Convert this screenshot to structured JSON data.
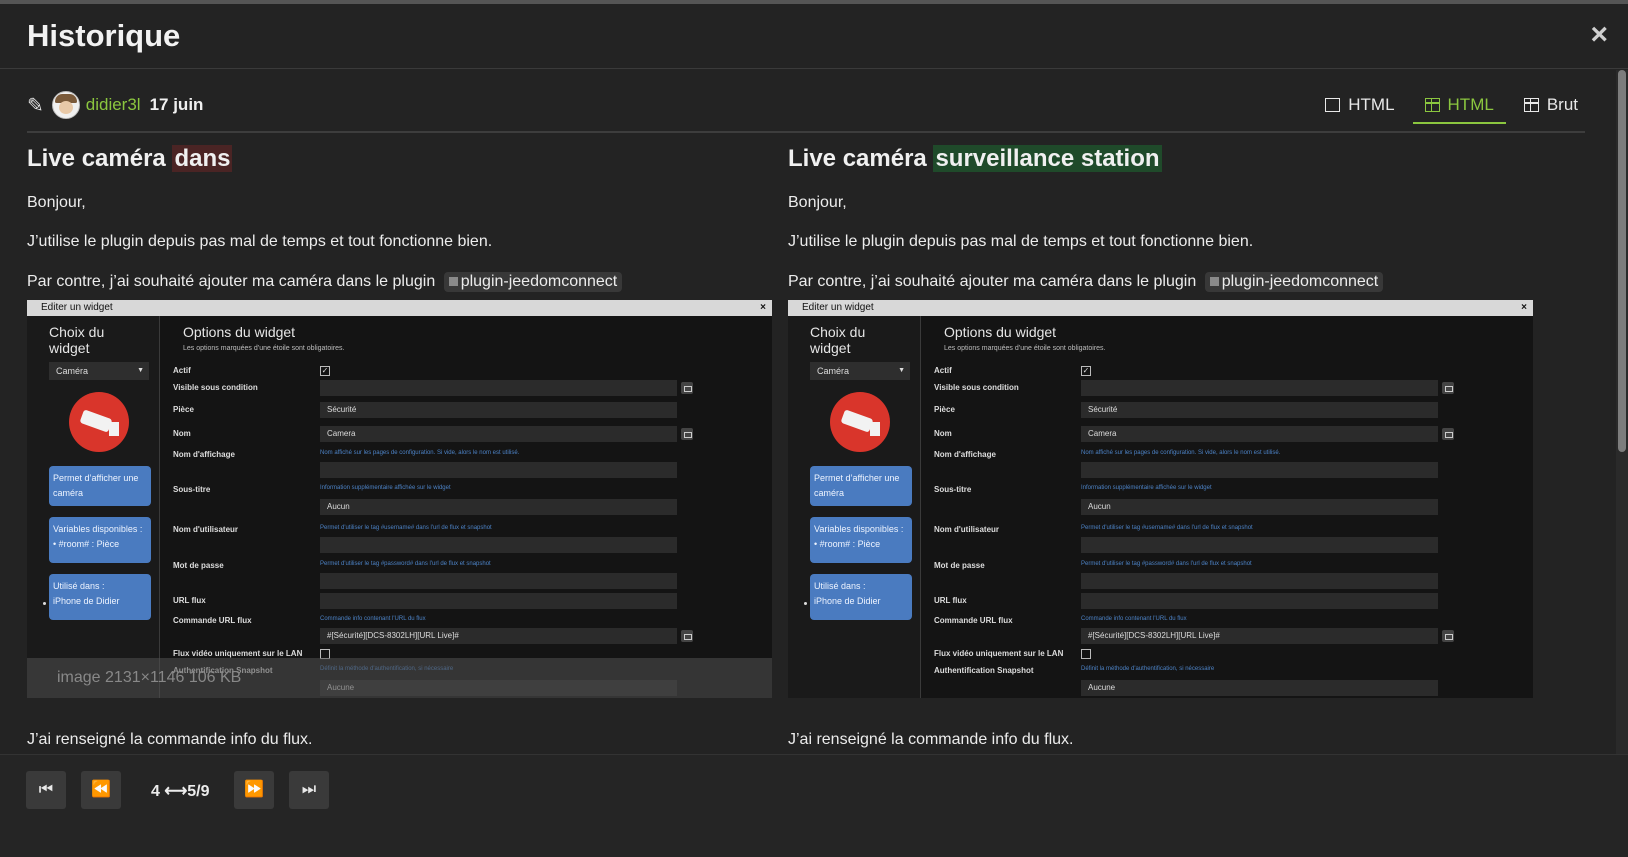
{
  "modal": {
    "title": "Historique",
    "close": "×"
  },
  "meta": {
    "username": "didier3l",
    "date": "17 juin"
  },
  "tabs": [
    {
      "label": "HTML",
      "icon": "square-icon",
      "active": false
    },
    {
      "label": "HTML",
      "icon": "split-view-icon",
      "active": true
    },
    {
      "label": "Brut",
      "icon": "columns-icon",
      "active": false
    }
  ],
  "colors": {
    "accent": "#8bc63f",
    "deletion": "#4a2424",
    "insertion": "#1f4a2a"
  },
  "left": {
    "title_plain": "Live caméra",
    "title_deleted": "dans",
    "p1": "Bonjour,",
    "p2": "J’utilise le plugin depuis pas mal de temps et tout fonctionne bien.",
    "p3": "Par contre, j’ai souhaité ajouter ma caméra dans le plugin",
    "tag": "plugin-jeedomconnect",
    "caption": "image 2131×1146 106 KB",
    "p4": "J’ai renseigné la commande info du flux."
  },
  "right": {
    "title_plain": "Live caméra",
    "title_inserted": "surveillance station",
    "p1": "Bonjour,",
    "p2": "J’utilise le plugin depuis pas mal de temps et tout fonctionne bien.",
    "p3": "Par contre, j’ai souhaité ajouter ma caméra dans le plugin",
    "tag": "plugin-jeedomconnect",
    "p4": "J’ai renseigné la commande info du flux."
  },
  "screenshot": {
    "window_title": "Editer un widget",
    "close": "×",
    "sidebar_title": "Choix du widget",
    "sidebar_select": "Caméra",
    "card1": "Permet d’afficher une caméra",
    "card2_title": "Variables disponibles :",
    "card2_item": "#room# : Pièce",
    "card3_title": "Utilisé dans :",
    "card3_item": "iPhone de Didier",
    "form_title": "Options du widget",
    "form_subtitle": "Les options marquées d’une étoile sont obligatoires.",
    "labels": {
      "actif": "Actif",
      "visible": "Visible sous condition",
      "piece": "Pièce",
      "nom": "Nom",
      "nom_affichage": "Nom d'affichage",
      "sous_titre": "Sous-titre",
      "nom_utilisateur": "Nom d'utilisateur",
      "mot_de_passe": "Mot de passe",
      "url_flux": "URL flux",
      "commande_url_flux": "Commande URL flux",
      "flux_lan": "Flux vidéo uniquement sur le LAN",
      "auth_snapshot": "Authentification Snapshot"
    },
    "values": {
      "piece": "Sécurité",
      "nom": "Camera",
      "sous_titre": "Aucun",
      "commande": "#[Sécurité][DCS-8302LH][URL Live]#",
      "auth": "Aucune"
    },
    "hints": {
      "nom_affichage": "Nom affiché sur les pages de configuration. Si vide, alors le nom est utilisé.",
      "sous_titre": "Information supplémentaire affichée sur le widget",
      "nom_utilisateur": "Permet d'utiliser le tag #username# dans l'url de flux et snapshot",
      "mot_de_passe": "Permet d'utiliser le tag #password# dans l'url de flux et snapshot",
      "commande": "Commande info contenant l'URL du flux",
      "auth": "Définit la méthode d'authentification, si nécessaire"
    }
  },
  "pagination": {
    "first": "⏮",
    "prev": "⏪",
    "label": "4 ⟷5/9",
    "next": "⏩",
    "last": "⏭"
  }
}
